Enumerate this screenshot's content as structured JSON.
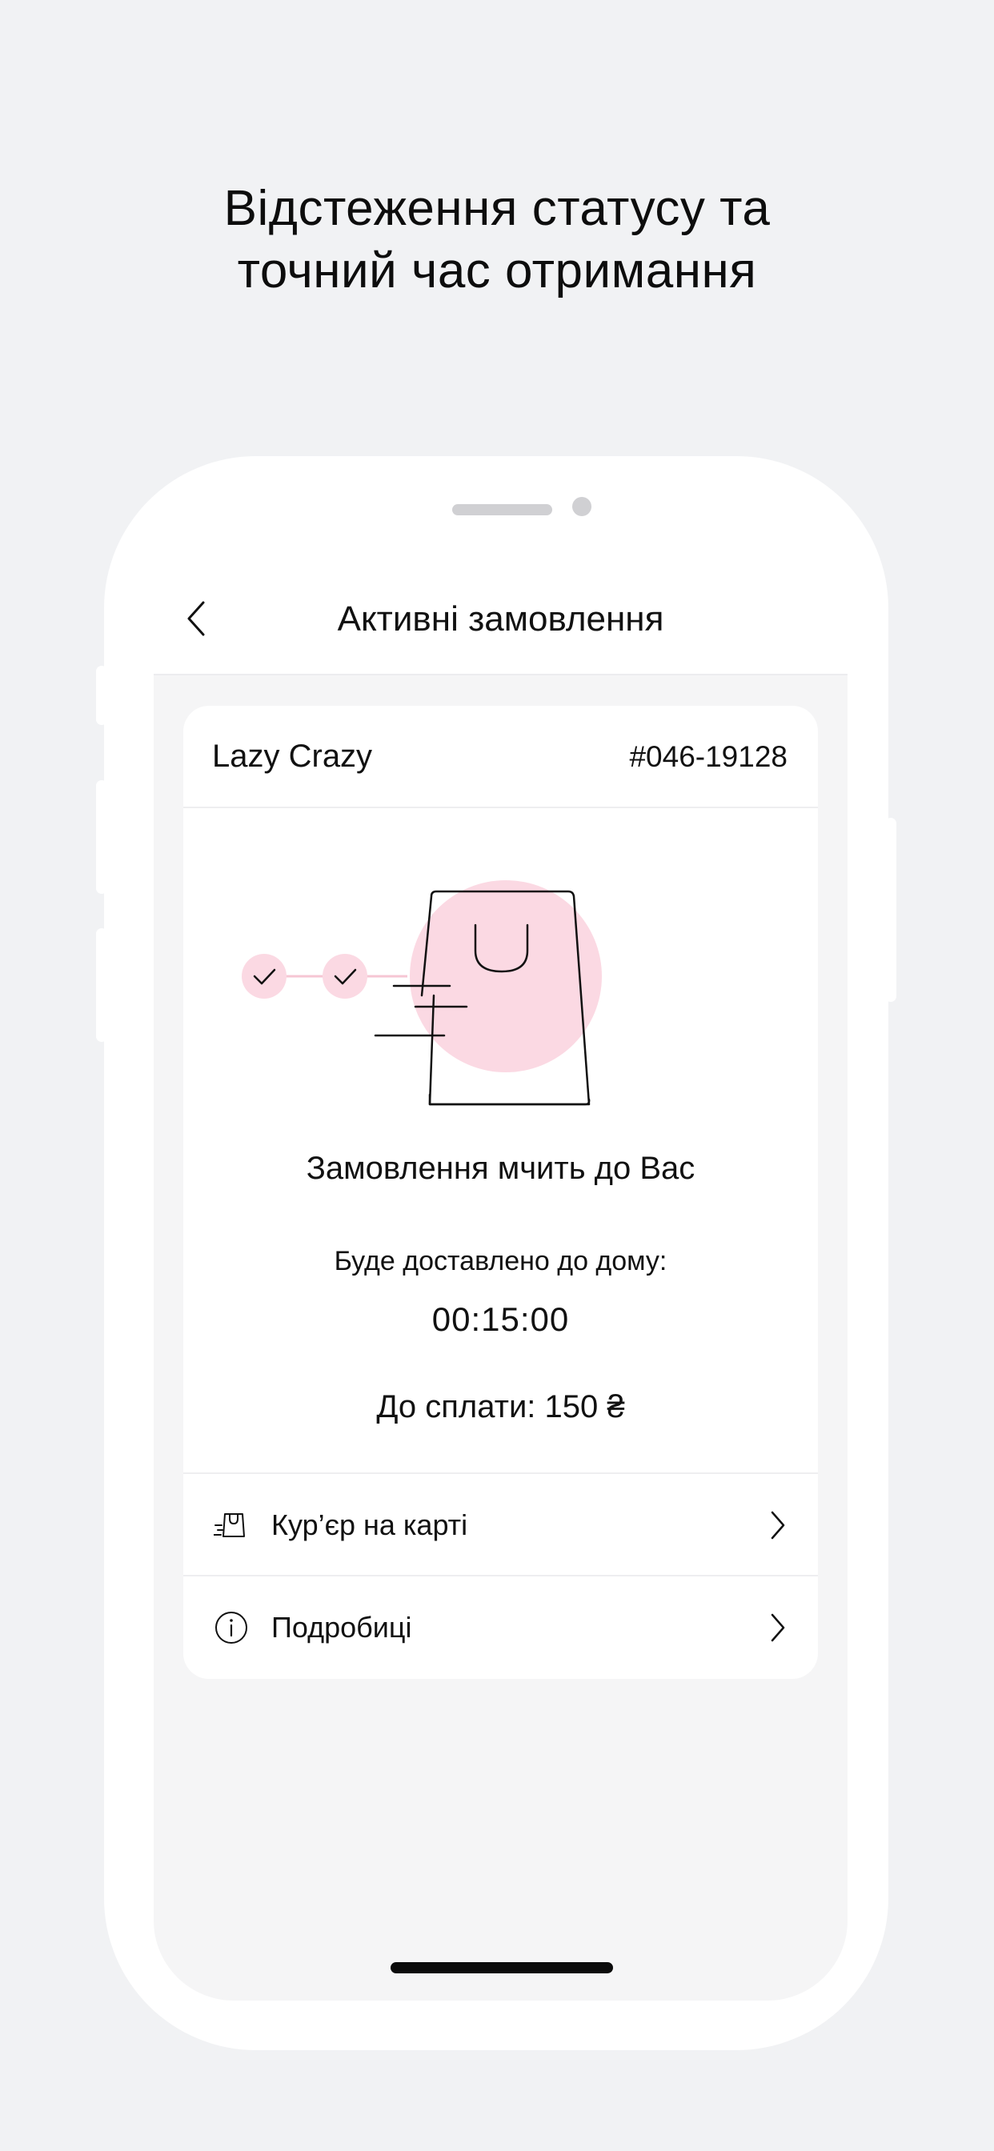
{
  "promo": {
    "headline_line1": "Відстеження статусу та",
    "headline_line2": "точний час отримання"
  },
  "nav": {
    "back_icon": "chevron-left-icon",
    "title": "Активні замовлення"
  },
  "order": {
    "store_name": "Lazy Crazy",
    "order_number": "#046-19128",
    "status_title": "Замовлення мчить до Вас",
    "delivery_label": "Буде доставлено до дому:",
    "delivery_time": "00:15:00",
    "payment": "До сплати: 150 ₴",
    "progress_steps_completed": 2
  },
  "actions": [
    {
      "label": "Кур’єр на карті",
      "icon": "courier-bag-icon"
    },
    {
      "label": "Подробиці",
      "icon": "info-icon"
    }
  ],
  "colors": {
    "accent_pink": "#fbd9e3",
    "background": "#f1f2f4",
    "content_bg": "#f5f5f6"
  }
}
